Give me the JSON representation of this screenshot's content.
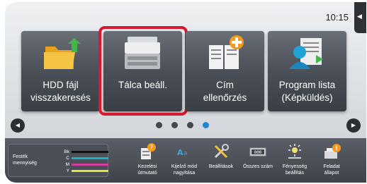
{
  "status": {
    "time": "10:15",
    "edge_icon": "speaker-icon"
  },
  "tiles": [
    {
      "line1": "HDD fájl",
      "line2": "visszakeresés",
      "icon": "folder-upload-icon"
    },
    {
      "line1": "Tálca beáll.",
      "line2": "",
      "icon": "printer-icon",
      "highlighted": true
    },
    {
      "line1": "Cím",
      "line2": "ellenőrzés",
      "icon": "address-book-add-icon"
    },
    {
      "line1": "Program lista",
      "line2": "(Képküldés)",
      "icon": "user-list-icon"
    }
  ],
  "pager": {
    "pages": 4,
    "active": 4,
    "prev_icon": "arrow-left-icon",
    "next_icon": "arrow-right-icon"
  },
  "toner": {
    "label_line1": "Festék",
    "label_line2": "mennyiség",
    "rows": [
      {
        "key": "Bk",
        "color": "#111111"
      },
      {
        "key": "C",
        "color": "#21b0c9"
      },
      {
        "key": "M",
        "color": "#d23aa0"
      },
      {
        "key": "Y",
        "color": "#e7e33a"
      }
    ]
  },
  "shortcuts": [
    {
      "line1": "Kezelési",
      "line2": "útmutató",
      "icon": "manual-help-icon"
    },
    {
      "line1": "Kijelző mód",
      "line2": "nagyítása",
      "icon": "text-enlarge-icon"
    },
    {
      "line1": "Beállítások",
      "line2": "",
      "icon": "tools-icon"
    },
    {
      "line1": "Összes szám",
      "line2": "",
      "icon": "counter-icon"
    },
    {
      "line1": "Fényesség",
      "line2": "beállítás",
      "icon": "brightness-icon"
    },
    {
      "line1": "Feladat",
      "line2": "állapot",
      "icon": "job-status-icon"
    }
  ]
}
